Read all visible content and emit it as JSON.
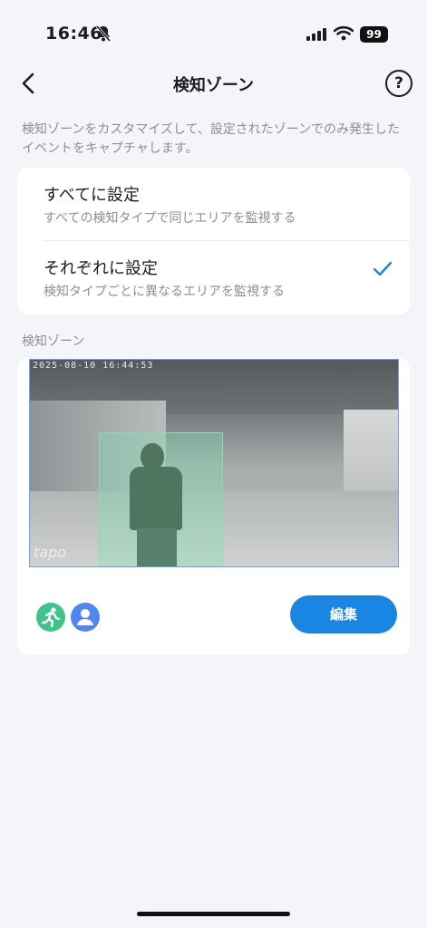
{
  "status_bar": {
    "time": "16:46",
    "battery": "99"
  },
  "nav": {
    "title": "検知ゾーン"
  },
  "description": "検知ゾーンをカスタマイズして、設定されたゾーンでのみ発生したイベントをキャプチャします。",
  "options": [
    {
      "title": "すべてに設定",
      "subtitle": "すべての検知タイプで同じエリアを監視する",
      "selected": false
    },
    {
      "title": "それぞれに設定",
      "subtitle": "検知タイプごとに異なるエリアを監視する",
      "selected": true
    }
  ],
  "zone_section": {
    "label": "検知ゾーン",
    "timestamp": "2025-08-10 16:44:53",
    "watermark": "tapo",
    "icons": [
      "motion-detection-icon",
      "person-detection-icon"
    ],
    "edit_label": "編集"
  },
  "colors": {
    "accent": "#1a86e3",
    "motion": "#3ec48a",
    "person": "#4f87ee",
    "zone": "#7fe0b8"
  }
}
